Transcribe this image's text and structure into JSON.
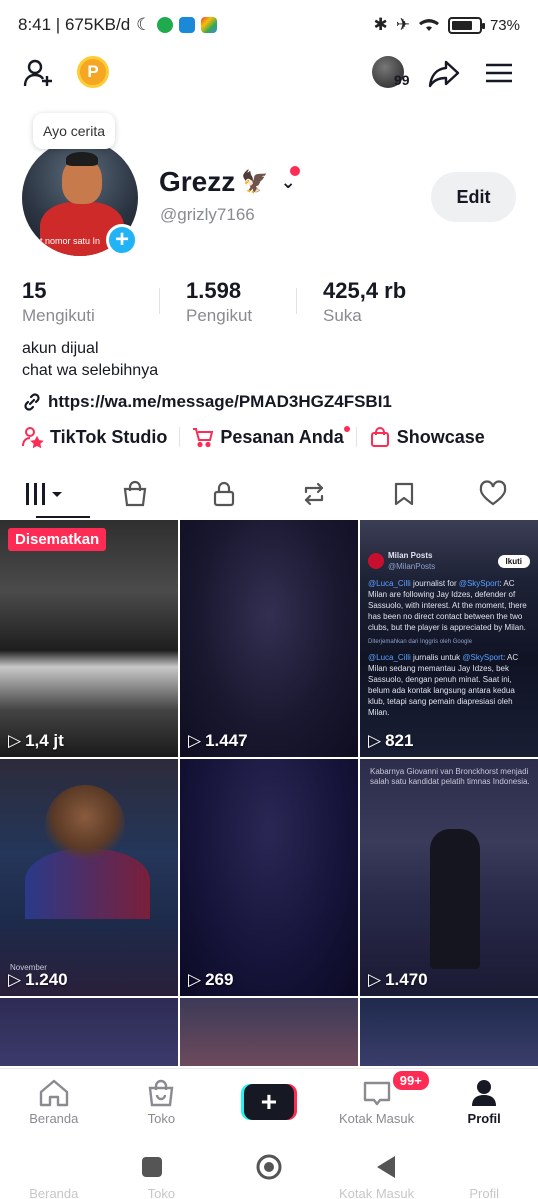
{
  "status_bar": {
    "time_speed": "8:41 | 675KB/d",
    "battery": "73%"
  },
  "header": {
    "story_count": "99"
  },
  "profile": {
    "tooltip": "Ayo cerita",
    "avatar_caption": "t nomor satu In",
    "display_name": "Grezz",
    "name_emoji": "🦅",
    "username": "@grizly7166",
    "edit_label": "Edit"
  },
  "stats": [
    {
      "value": "15",
      "label": "Mengikuti"
    },
    {
      "value": "1.598",
      "label": "Pengikut"
    },
    {
      "value": "425,4 rb",
      "label": "Suka"
    }
  ],
  "bio": {
    "line1": "akun dijual",
    "line2": "chat wa selebihnya"
  },
  "link": "https://wa.me/message/PMAD3HGZ4FSBI1",
  "shortcuts": [
    {
      "label": "TikTok Studio",
      "icon": "person-star-icon"
    },
    {
      "label": "Pesanan Anda",
      "icon": "cart-icon"
    },
    {
      "label": "Showcase",
      "icon": "shopping-bag-icon"
    }
  ],
  "tabs": [
    "videos",
    "shop",
    "private",
    "reposts",
    "favorites",
    "liked"
  ],
  "videos": [
    {
      "views": "1,4 jt",
      "pinned": "Disematkan"
    },
    {
      "views": "1.447"
    },
    {
      "views": "821"
    },
    {
      "views": "1.240"
    },
    {
      "views": "269"
    },
    {
      "views": "1.470"
    }
  ],
  "tweet_card": {
    "account": "Milan Posts",
    "handle": "@MilanPosts",
    "follow": "Ikuti",
    "tag1": "@Luca_Cilli",
    "tag1_text": " journalist for ",
    "tag2": "@SkySport",
    "body_en": ": AC Milan are following Jay Idzes, defender of Sassuolo, with interest. At the moment, there has been no direct contact between the two clubs, but the player is appreciated by Milan.",
    "translated_by": "Diterjemahkan dari Inggris oleh Google",
    "tag3": "@Luca_Cilli",
    "tag3_text": " jurnalis untuk ",
    "tag4": "@SkySport",
    "body_id": ": AC Milan sedang memantau Jay Idzes, bek Sassuolo, dengan penuh minat. Saat ini, belum ada kontak langsung antara kedua klub, tetapi sang pemain diapresiasi oleh Milan."
  },
  "video_caption_6": "Kabarnya Giovanni van Bronckhorst menjadi salah satu kandidat pelatih timnas Indonesia.",
  "video_caption_4": "November",
  "bottom_nav": [
    {
      "label": "Beranda",
      "icon": "home-icon"
    },
    {
      "label": "Toko",
      "icon": "shop-icon"
    },
    {
      "label": "",
      "icon": "create-icon"
    },
    {
      "label": "Kotak Masuk",
      "icon": "inbox-icon",
      "badge": "99+"
    },
    {
      "label": "Profil",
      "icon": "profile-icon"
    }
  ],
  "colors": {
    "accent": "#fe2c55",
    "cyan": "#25f4ee",
    "text": "#161823",
    "muted": "#8a8b91"
  }
}
